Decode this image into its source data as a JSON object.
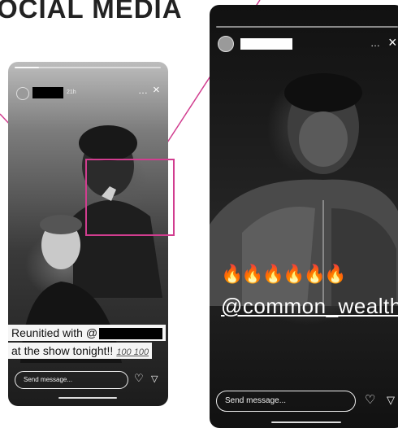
{
  "heading": "OCIAL MEDIA",
  "left_story": {
    "time": "21h",
    "menu": "…",
    "close": "×",
    "caption_line1_prefix": "Reunitied with @",
    "caption_line2": "at the show tonight!!",
    "caption_emoji": "100 100",
    "send_placeholder": "Send message...",
    "like_icon": "♡",
    "share_icon": "▽"
  },
  "right_story": {
    "menu": "…",
    "close": "×",
    "fires": "🔥🔥🔥🔥🔥🔥",
    "mention": "@common_wealthhc",
    "send_placeholder": "Send message...",
    "like_icon": "♡",
    "share_icon": "▽"
  },
  "colors": {
    "highlight": "#d13d8f"
  }
}
